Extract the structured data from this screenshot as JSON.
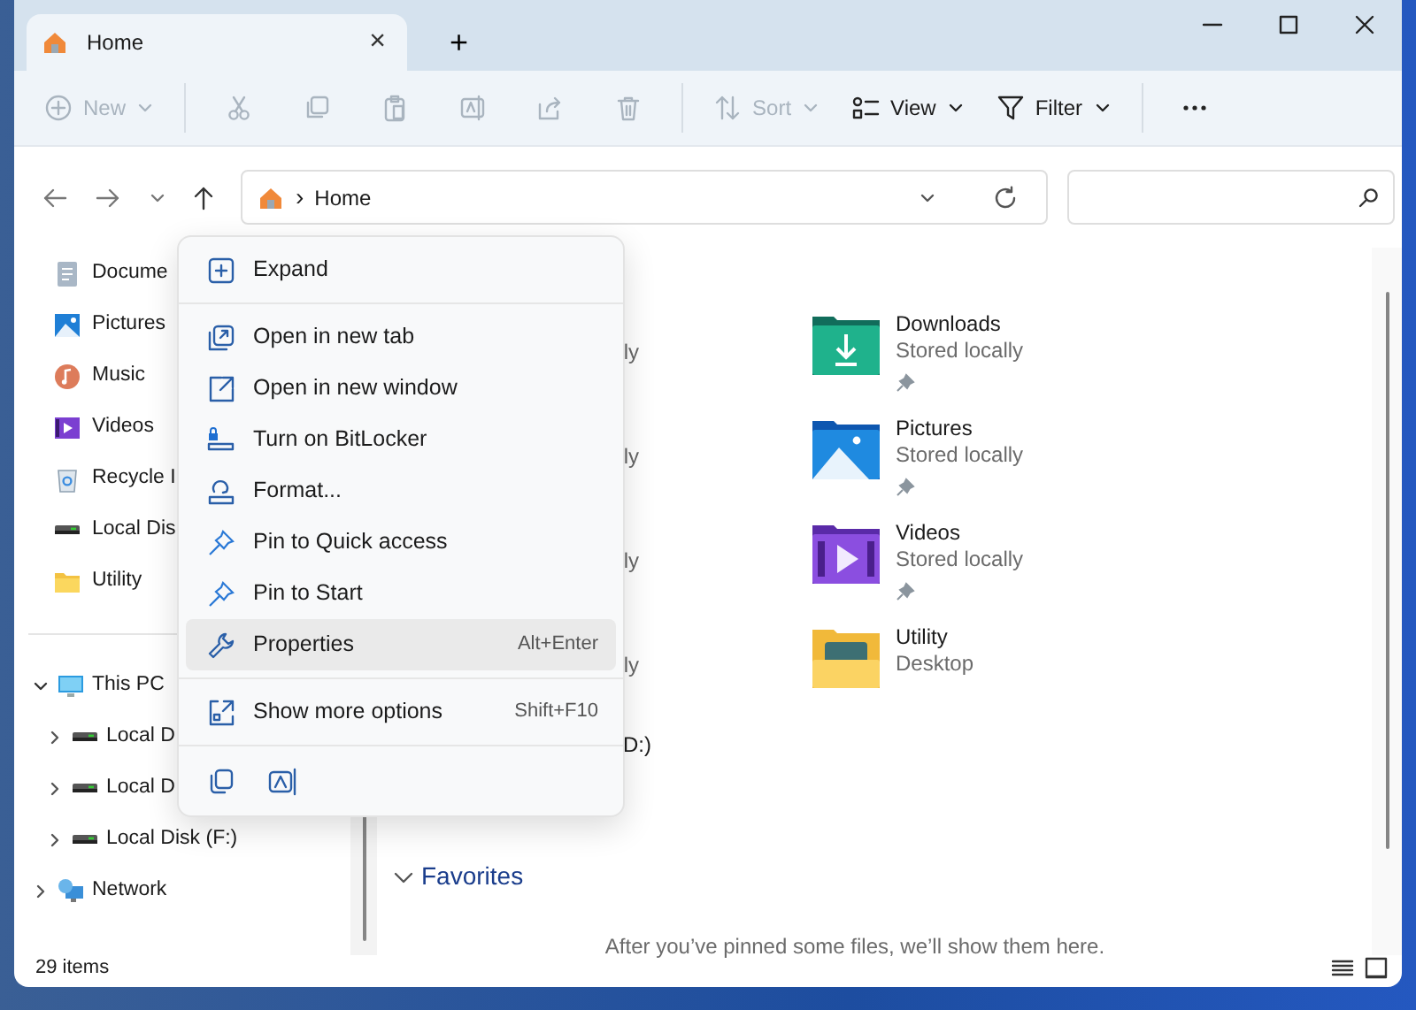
{
  "tab": {
    "title": "Home",
    "close": "×",
    "selected": true
  },
  "new_tab": "+",
  "toolbar": [
    {
      "label": "New",
      "disabled": true,
      "dropdown": true
    },
    {
      "disabled": true
    },
    {
      "disabled": true
    },
    {
      "disabled": true
    },
    {
      "disabled": true
    },
    {
      "disabled": true
    },
    {
      "disabled": true
    },
    {
      "label": "Sort",
      "disabled": true,
      "dropdown": true
    },
    {
      "label": "View",
      "disabled": false,
      "dropdown": true
    },
    {
      "label": "Filter",
      "disabled": false,
      "dropdown": true
    },
    {
      "disabled": false
    }
  ],
  "address": {
    "location": "Home",
    "separator": "›"
  },
  "sidebar": [
    {
      "label": "Docume"
    },
    {
      "label": "Pictures"
    },
    {
      "label": "Music"
    },
    {
      "label": "Videos"
    },
    {
      "label": "Recycle I"
    },
    {
      "label": "Local Dis"
    },
    {
      "label": "Utility"
    }
  ],
  "tree": [
    {
      "label": "This PC",
      "expanded": true,
      "children": [
        {
          "label": "Local D",
          "expanded": false
        },
        {
          "label": "Local D",
          "expanded": false
        },
        {
          "label": "Local Disk (F:)",
          "expanded": false
        }
      ]
    },
    {
      "label": "Network",
      "expanded": false
    }
  ],
  "main": {
    "left_fragments": [
      "ly",
      "ly",
      "ly",
      "ly"
    ],
    "quick_access": [
      {
        "name": "Downloads",
        "location": "Stored locally",
        "pinned": true
      },
      {
        "name": "Pictures",
        "location": "Stored locally",
        "pinned": true
      },
      {
        "name": "Videos",
        "location": "Stored locally",
        "pinned": true
      },
      {
        "name": "Utility",
        "location": "Desktop",
        "pinned": false
      }
    ],
    "drive_fragment": "D:)",
    "favorites": {
      "title": "Favorites",
      "expanded": true,
      "empty_message": "After you’ve pinned some files, we’ll show them here."
    }
  },
  "context_menu": {
    "groups": [
      [
        {
          "label": "Expand",
          "selected": false
        }
      ],
      [
        {
          "label": "Open in new tab",
          "selected": false
        },
        {
          "label": "Open in new window",
          "selected": false
        },
        {
          "label": "Turn on BitLocker",
          "selected": false
        },
        {
          "label": "Format...",
          "selected": false
        },
        {
          "label": "Pin to Quick access",
          "selected": false
        },
        {
          "label": "Pin to Start",
          "selected": false
        },
        {
          "label": "Properties",
          "shortcut": "Alt+Enter",
          "selected": true
        }
      ],
      [
        {
          "label": "Show more options",
          "shortcut": "Shift+F10",
          "selected": false
        }
      ]
    ]
  },
  "status_bar": {
    "item_count": "29 items"
  }
}
